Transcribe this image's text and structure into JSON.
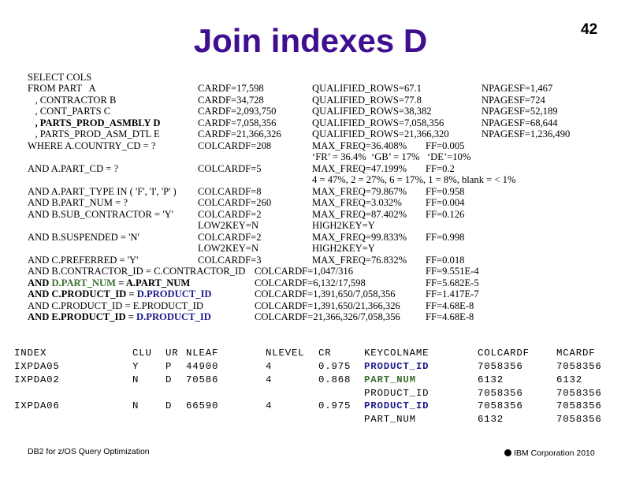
{
  "header": {
    "title": "Join indexes D",
    "page_number": "42"
  },
  "query": {
    "lines": [
      {
        "sql": "SELECT COLS",
        "stat1": "",
        "stat2": "",
        "stat3": "",
        "stat4": ""
      },
      {
        "sql": "FROM PART   A",
        "stat1": "CARDF=17,598",
        "stat2": "QUALIFIED_ROWS=67.1",
        "stat3": "",
        "stat4": "NPAGESF=1,467"
      },
      {
        "sql": "   , CONTRACTOR B",
        "stat1": "CARDF=34,728",
        "stat2": "QUALIFIED_ROWS=77.8",
        "stat3": "",
        "stat4": "NPAGESF=724"
      },
      {
        "sql": "   , CONT_PARTS C",
        "stat1": "CARDF=2,093,750",
        "stat2": "QUALIFIED_ROWS=38,382",
        "stat3": "",
        "stat4": "NPAGESF=52,189"
      },
      {
        "sql": "   , PARTS_PROD_ASMBLY D",
        "stat1": "CARDF=7,058,356",
        "stat2": "QUALIFIED_ROWS=7,058,356",
        "stat3": "",
        "stat4": "NPAGESF=68,644"
      },
      {
        "sql": "   , PARTS_PROD_ASM_DTL E",
        "stat1": "CARDF=21,366,326",
        "stat2": "QUALIFIED_ROWS=21,366,320",
        "stat3": "",
        "stat4": "NPAGESF=1,236,490"
      },
      {
        "sql": "WHERE A.COUNTRY_CD = ?",
        "stat1": "COLCARDF=208",
        "stat2": "MAX_FREQ=36.408%",
        "stat3": "FF=0.005",
        "stat4": ""
      },
      {
        "sql": "",
        "stat1": "",
        "stat2": "‘FR’ = 36.4%  ‘GB’ = 17%   ‘DE’=10%",
        "stat3": "",
        "stat4": ""
      },
      {
        "sql": "AND A.PART_CD = ?",
        "stat1": "COLCARDF=5",
        "stat2": "MAX_FREQ=47.199%",
        "stat3": "FF=0.2",
        "stat4": ""
      },
      {
        "sql": "",
        "stat1": "",
        "stat2": "4 = 47%, 2 = 27%, 6 = 17%, 1 = 8%, blank = < 1%",
        "stat3": "",
        "stat4": ""
      },
      {
        "sql": "AND A.PART_TYPE IN ( 'F', 'I', 'P' )",
        "stat1": "COLCARDF=8",
        "stat2": "MAX_FREQ=79.867%",
        "stat3": "FF=0.958",
        "stat4": ""
      },
      {
        "sql": "AND B.PART_NUM = ?",
        "stat1": "COLCARDF=260",
        "stat2": "MAX_FREQ=3.032%",
        "stat3": "FF=0.004",
        "stat4": ""
      },
      {
        "sql": "AND B.SUB_CONTRACTOR = 'Y'",
        "stat1": "COLCARDF=2",
        "stat2": "MAX_FREQ=87.402%",
        "stat3": "FF=0.126",
        "stat4": ""
      },
      {
        "sql": "",
        "stat1": "LOW2KEY=N",
        "stat2": "HIGH2KEY=Y",
        "stat3": "",
        "stat4": ""
      },
      {
        "sql": "AND B.SUSPENDED = 'N'",
        "stat1": "COLCARDF=2",
        "stat2": "MAX_FREQ=99.833%",
        "stat3": "FF=0.998",
        "stat4": ""
      },
      {
        "sql": "",
        "stat1": "LOW2KEY=N",
        "stat2": "HIGH2KEY=Y",
        "stat3": "",
        "stat4": ""
      },
      {
        "sql": "AND C.PREFERRED = 'Y'",
        "stat1": "COLCARDF=3",
        "stat2": "MAX_FREQ=76.832%",
        "stat3": "FF=0.018",
        "stat4": ""
      }
    ],
    "joins": [
      {
        "sql_a": "AND B.CONTRACTOR_ID = C.CONTRACTOR_ID",
        "sql_b": "",
        "colcard": "COLCARDF=1,047/316",
        "ff": "FF=9.551E-4"
      },
      {
        "sql_a": "AND ",
        "sql_b": "D.PART_NUM",
        "sql_c": " = A.PART_NUM",
        "colcard": "COLCARDF=6,132/17,598",
        "ff": "FF=5.682E-5"
      },
      {
        "sql_a": "AND C.PRODUCT_ID = ",
        "sql_b": "D.PRODUCT_ID",
        "colcard": "COLCARDF=1,391,650/7,058,356",
        "ff": "FF=1.417E-7"
      },
      {
        "sql_a": "AND C.PRODUCT_ID = E.PRODUCT_ID",
        "sql_b": "",
        "colcard": "COLCARDF=1,391,650/21,366,326",
        "ff": "FF=4.68E-8"
      },
      {
        "sql_a": "AND E.PRODUCT_ID = ",
        "sql_b": "D.PRODUCT_ID",
        "colcard": "COLCARDF=21,366,326/7,058,356",
        "ff": "FF=4.68E-8"
      }
    ]
  },
  "index_table": {
    "headers": [
      "INDEX",
      "CLU",
      "UR",
      "NLEAF",
      "NLEVEL",
      "CR",
      "KEYCOLNAME",
      "COLCARDF",
      "MCARDF"
    ],
    "rows": [
      [
        "IXPDA05",
        "Y",
        "P",
        "44900",
        "4",
        "0.975",
        "PRODUCT_ID",
        "7058356",
        "7058356"
      ],
      [
        "IXPDA02",
        "N",
        "D",
        "70586",
        "4",
        "0.868",
        "PART_NUM",
        "6132",
        "6132"
      ],
      [
        "",
        "",
        "",
        "",
        "",
        "",
        "PRODUCT_ID",
        "7058356",
        "7058356"
      ],
      [
        "IXPDA06",
        "N",
        "D",
        "66590",
        "4",
        "0.975",
        "PRODUCT_ID",
        "7058356",
        "7058356"
      ],
      [
        "",
        "",
        "",
        "",
        "",
        "",
        "PART_NUM",
        "6132",
        "7058356"
      ]
    ]
  },
  "footer": {
    "left": "DB2 for z/OS Query Optimization",
    "right": "IBM Corporation 2010"
  },
  "colors": {
    "title": "#3f0f8f",
    "green": "#3a6f2e",
    "blue": "#1a1a8c"
  }
}
